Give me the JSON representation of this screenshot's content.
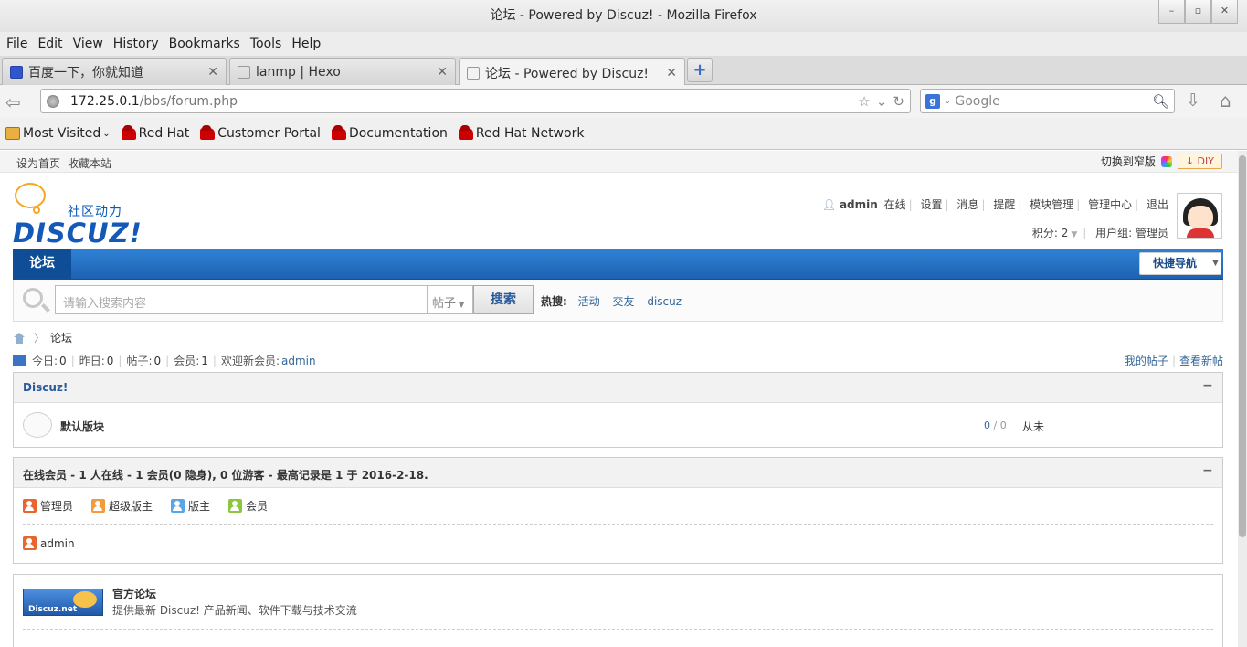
{
  "window": {
    "title": "论坛 - Powered by Discuz! - Mozilla Firefox"
  },
  "menu": [
    "File",
    "Edit",
    "View",
    "History",
    "Bookmarks",
    "Tools",
    "Help"
  ],
  "tabs": [
    {
      "label": "百度一下，你就知道",
      "active": false
    },
    {
      "label": "lanmp | Hexo",
      "active": false
    },
    {
      "label": "论坛 - Powered by Discuz!",
      "active": true
    }
  ],
  "url": {
    "host": "172.25.0.1",
    "path": "/bbs/forum.php"
  },
  "search": {
    "placeholder": "Google",
    "engine_icon": "g"
  },
  "bookmarks": [
    {
      "label": "Most Visited",
      "icon": "folder-icon"
    },
    {
      "label": "Red Hat",
      "icon": "redhat-icon"
    },
    {
      "label": "Customer Portal",
      "icon": "redhat-icon"
    },
    {
      "label": "Documentation",
      "icon": "redhat-icon"
    },
    {
      "label": "Red Hat Network",
      "icon": "redhat-icon"
    }
  ],
  "site": {
    "topleft": [
      "设为首页",
      "收藏本站"
    ],
    "switch_label": "切换到窄版",
    "diy_label": "↓ DIY",
    "logo_cn": "社区动力",
    "logo_en": "DISCUZ!",
    "user": {
      "name": "admin",
      "status": "在线",
      "links": [
        "设置",
        "消息",
        "提醒",
        "模块管理",
        "管理中心",
        "退出"
      ],
      "points": "积分: 2",
      "group": "用户组: 管理员"
    },
    "nav_tab": "论坛",
    "quick_nav": "快捷导航",
    "search_placeholder": "请输入搜索内容",
    "search_type": "帖子",
    "search_button": "搜索",
    "hot_label": "热搜:",
    "hot_terms": [
      "活动",
      "交友",
      "discuz"
    ],
    "breadcrumb": "论坛",
    "stats": {
      "today_label": "今日:",
      "today": "0",
      "yest_label": "昨日:",
      "yest": "0",
      "posts_label": "帖子:",
      "posts": "0",
      "members_label": "会员:",
      "members": "1",
      "welcome": "欢迎新会员:",
      "newest": "admin"
    },
    "my_posts": "我的帖子",
    "new_posts": "查看新帖",
    "category": "Discuz!",
    "forum": {
      "name": "默认版块",
      "threads": "0",
      "posts": "0",
      "last": "从未"
    },
    "online": {
      "header": "在线会员 - 1 人在线 - 1 会员(0 隐身), 0 位游客 - 最高记录是 1 于 2016-2-18.",
      "legend": [
        {
          "label": "管理员",
          "color": "#e8652f"
        },
        {
          "label": "超级版主",
          "color": "#f39a3a"
        },
        {
          "label": "版主",
          "color": "#58a6e6"
        },
        {
          "label": "会员",
          "color": "#8cc63f"
        }
      ],
      "user": "admin"
    },
    "links": {
      "badge": "Discuz.net",
      "title": "官方论坛",
      "desc": "提供最新 Discuz! 产品新闻、软件下载与技术交流"
    }
  }
}
